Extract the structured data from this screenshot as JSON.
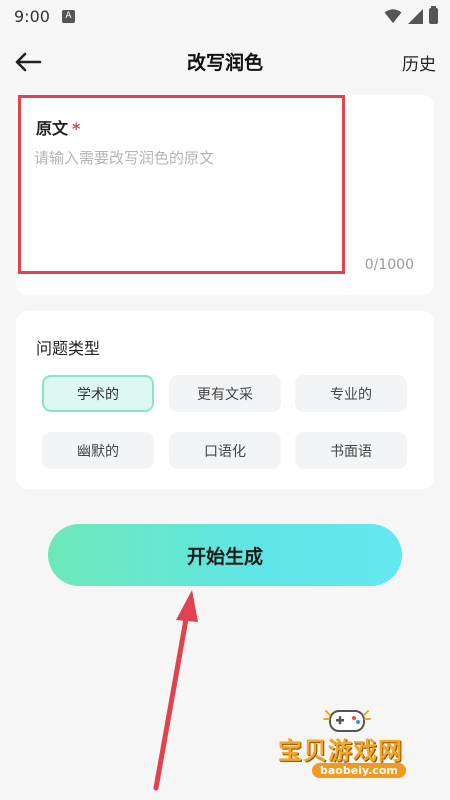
{
  "status_bar": {
    "time": "9:00",
    "notification_icon": "A",
    "icons": [
      "wifi-icon",
      "signal-icon",
      "battery-icon"
    ]
  },
  "header": {
    "back_icon": "arrow-left-icon",
    "title": "改写润色",
    "history_label": "历史"
  },
  "original_text": {
    "label": "原文",
    "required_mark": "*",
    "placeholder": "请输入需要改写润色的原文",
    "value": "",
    "char_count": "0/1000"
  },
  "question_type": {
    "title": "问题类型",
    "options": [
      {
        "label": "学术的",
        "selected": true
      },
      {
        "label": "更有文采",
        "selected": false
      },
      {
        "label": "专业的",
        "selected": false
      },
      {
        "label": "幽默的",
        "selected": false
      },
      {
        "label": "口语化",
        "selected": false
      },
      {
        "label": "书面语",
        "selected": false
      }
    ]
  },
  "generate_button": {
    "label": "开始生成"
  },
  "watermark": {
    "title": "宝贝游戏网",
    "url": "baobeiy.com"
  },
  "colors": {
    "highlight_border": "#e0434f",
    "selected_chip_bg": "#ddf7f1",
    "selected_chip_border": "#8be3cd",
    "button_gradient_start": "#6de9b8",
    "button_gradient_end": "#63e8f0"
  }
}
